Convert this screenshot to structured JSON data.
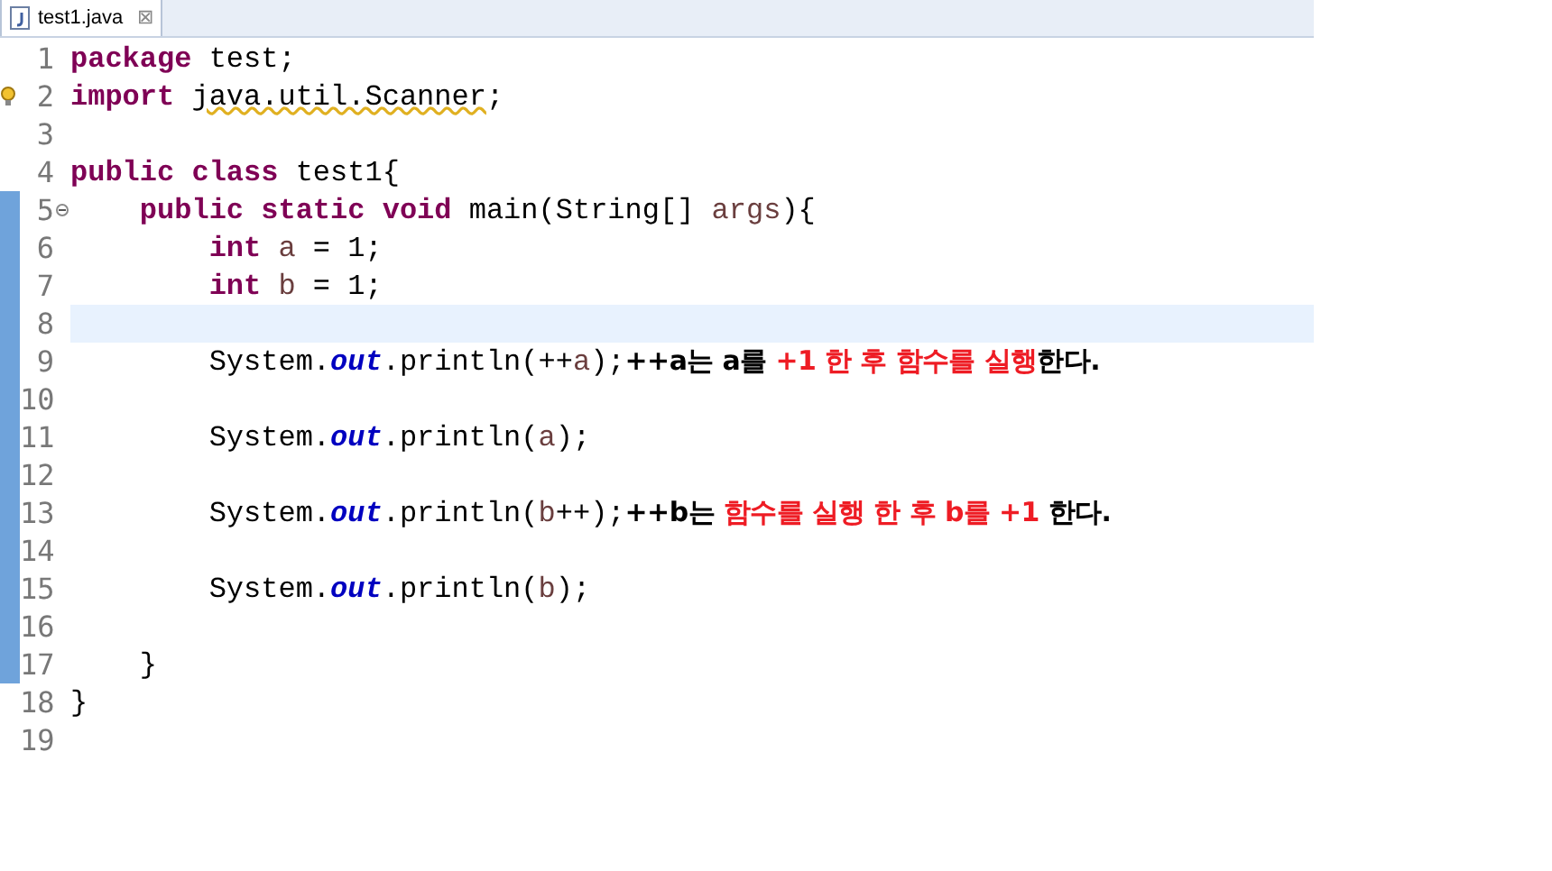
{
  "tab": {
    "title": "test1.java",
    "close": "⊠"
  },
  "lines": [
    {
      "number": "1",
      "warning": false,
      "foldable": false,
      "changed": false,
      "current": false,
      "tokens": [
        {
          "kind": "keyword",
          "text": "package"
        },
        {
          "kind": "text",
          "text": " test;"
        }
      ]
    },
    {
      "number": "2",
      "warning": true,
      "foldable": false,
      "changed": false,
      "current": false,
      "tokens": [
        {
          "kind": "keyword",
          "text": "import "
        },
        {
          "kind": "warned",
          "text": "java.util.Scanner"
        },
        {
          "kind": "text",
          "text": ";"
        }
      ]
    },
    {
      "number": "3",
      "warning": false,
      "foldable": false,
      "changed": false,
      "current": false
    },
    {
      "number": "4",
      "warning": false,
      "foldable": false,
      "changed": false,
      "current": false,
      "tokens": [
        {
          "kind": "keyword",
          "text": "public"
        },
        {
          "kind": "keyword",
          "text": " class"
        },
        {
          "kind": "text",
          "text": " test1{"
        }
      ]
    },
    {
      "number": "5",
      "warning": false,
      "foldable": true,
      "changed": true,
      "current": false,
      "tokens": [
        {
          "kind": "keyword",
          "text": "    public"
        },
        {
          "kind": "keyword",
          "text": " static"
        },
        {
          "kind": "keyword",
          "text": " void"
        },
        {
          "kind": "text",
          "text": " main(String[] "
        },
        {
          "kind": "param",
          "text": "args"
        },
        {
          "kind": "text",
          "text": "){"
        }
      ]
    },
    {
      "number": "6",
      "warning": false,
      "foldable": false,
      "changed": true,
      "current": false,
      "tokens": [
        {
          "kind": "keyword",
          "text": "        int"
        },
        {
          "kind": "param",
          "text": " a"
        },
        {
          "kind": "text",
          "text": " = 1;"
        }
      ]
    },
    {
      "number": "7",
      "warning": false,
      "foldable": false,
      "changed": true,
      "current": false,
      "tokens": [
        {
          "kind": "keyword",
          "text": "        int"
        },
        {
          "kind": "param",
          "text": " b"
        },
        {
          "kind": "text",
          "text": " = 1;"
        }
      ]
    },
    {
      "number": "8",
      "warning": false,
      "foldable": false,
      "changed": true,
      "current": true
    },
    {
      "number": "9",
      "warning": false,
      "foldable": false,
      "changed": true,
      "current": false,
      "tokens": [
        {
          "kind": "text",
          "text": "        System."
        },
        {
          "kind": "field",
          "text": "out"
        },
        {
          "kind": "text",
          "text": ".println(++"
        },
        {
          "kind": "param",
          "text": "a"
        },
        {
          "kind": "text",
          "text": ");"
        }
      ],
      "note": [
        {
          "text": "++a는 a를 ",
          "highlight": false
        },
        {
          "text": "+1 한 후 함수를 실행",
          "highlight": true
        },
        {
          "text": "한다.",
          "highlight": false
        }
      ]
    },
    {
      "number": "10",
      "warning": false,
      "foldable": false,
      "changed": true,
      "current": false
    },
    {
      "number": "11",
      "warning": false,
      "foldable": false,
      "changed": true,
      "current": false,
      "tokens": [
        {
          "kind": "text",
          "text": "        System."
        },
        {
          "kind": "field",
          "text": "out"
        },
        {
          "kind": "text",
          "text": ".println("
        },
        {
          "kind": "param",
          "text": "a"
        },
        {
          "kind": "text",
          "text": ");"
        }
      ]
    },
    {
      "number": "12",
      "warning": false,
      "foldable": false,
      "changed": true,
      "current": false
    },
    {
      "number": "13",
      "warning": false,
      "foldable": false,
      "changed": true,
      "current": false,
      "tokens": [
        {
          "kind": "text",
          "text": "        System."
        },
        {
          "kind": "field",
          "text": "out"
        },
        {
          "kind": "text",
          "text": ".println("
        },
        {
          "kind": "param",
          "text": "b"
        },
        {
          "kind": "text",
          "text": "++);"
        }
      ],
      "note": [
        {
          "text": "++b는 ",
          "highlight": false
        },
        {
          "text": "함수를 실행 한 후 b를 +1",
          "highlight": true
        },
        {
          "text": " 한다.",
          "highlight": false
        }
      ]
    },
    {
      "number": "14",
      "warning": false,
      "foldable": false,
      "changed": true,
      "current": false
    },
    {
      "number": "15",
      "warning": false,
      "foldable": false,
      "changed": true,
      "current": false,
      "tokens": [
        {
          "kind": "text",
          "text": "        System."
        },
        {
          "kind": "field",
          "text": "out"
        },
        {
          "kind": "text",
          "text": ".println("
        },
        {
          "kind": "param",
          "text": "b"
        },
        {
          "kind": "text",
          "text": ");"
        }
      ]
    },
    {
      "number": "16",
      "warning": false,
      "foldable": false,
      "changed": true,
      "current": false
    },
    {
      "number": "17",
      "warning": false,
      "foldable": false,
      "changed": true,
      "current": false,
      "tokens": [
        {
          "kind": "text",
          "text": "    }"
        }
      ]
    },
    {
      "number": "18",
      "warning": false,
      "foldable": false,
      "changed": false,
      "current": false,
      "tokens": [
        {
          "kind": "text",
          "text": "}"
        }
      ]
    },
    {
      "number": "19",
      "warning": false,
      "foldable": false,
      "changed": false,
      "current": false
    }
  ]
}
